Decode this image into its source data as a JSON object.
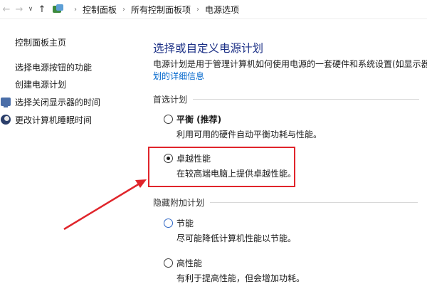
{
  "nav": {
    "back_icon": "arrow-left-icon",
    "forward_icon": "arrow-right-icon",
    "recent_icon": "chevron-down-icon",
    "up_icon": "arrow-up-icon",
    "breadcrumbs": [
      "控制面板",
      "所有控制面板项",
      "电源选项"
    ]
  },
  "sidebar": {
    "items": [
      {
        "label": "控制面板主页",
        "icon": ""
      },
      {
        "label": "选择电源按钮的功能",
        "icon": ""
      },
      {
        "label": "创建电源计划",
        "icon": ""
      },
      {
        "label": "选择关闭显示器的时间",
        "icon": "display-icon"
      },
      {
        "label": "更改计算机睡眠时间",
        "icon": "sleep-icon"
      }
    ]
  },
  "main": {
    "title": "选择或自定义电源计划",
    "description_line1": "电源计划是用于管理计算机如何使用电源的一套硬件和系统设置(如显示器",
    "description_link": "划的详细信息",
    "preferred_heading": "首选计划",
    "hidden_heading": "隐藏附加计划",
    "plans": [
      {
        "name": "平衡 (推荐)",
        "description": "利用可用的硬件自动平衡功耗与性能。",
        "selected": false
      },
      {
        "name": "卓越性能",
        "description": "在较高端电脑上提供卓越性能。",
        "selected": true
      },
      {
        "name": "节能",
        "description": "尽可能降低计算机性能以节能。",
        "selected": false
      },
      {
        "name": "高性能",
        "description": "有利于提高性能，但会增加功耗。",
        "selected": false
      }
    ]
  },
  "colors": {
    "title": "#1e3287",
    "link": "#0066cc",
    "highlight": "#e0252b",
    "arrow": "#e0252b"
  }
}
